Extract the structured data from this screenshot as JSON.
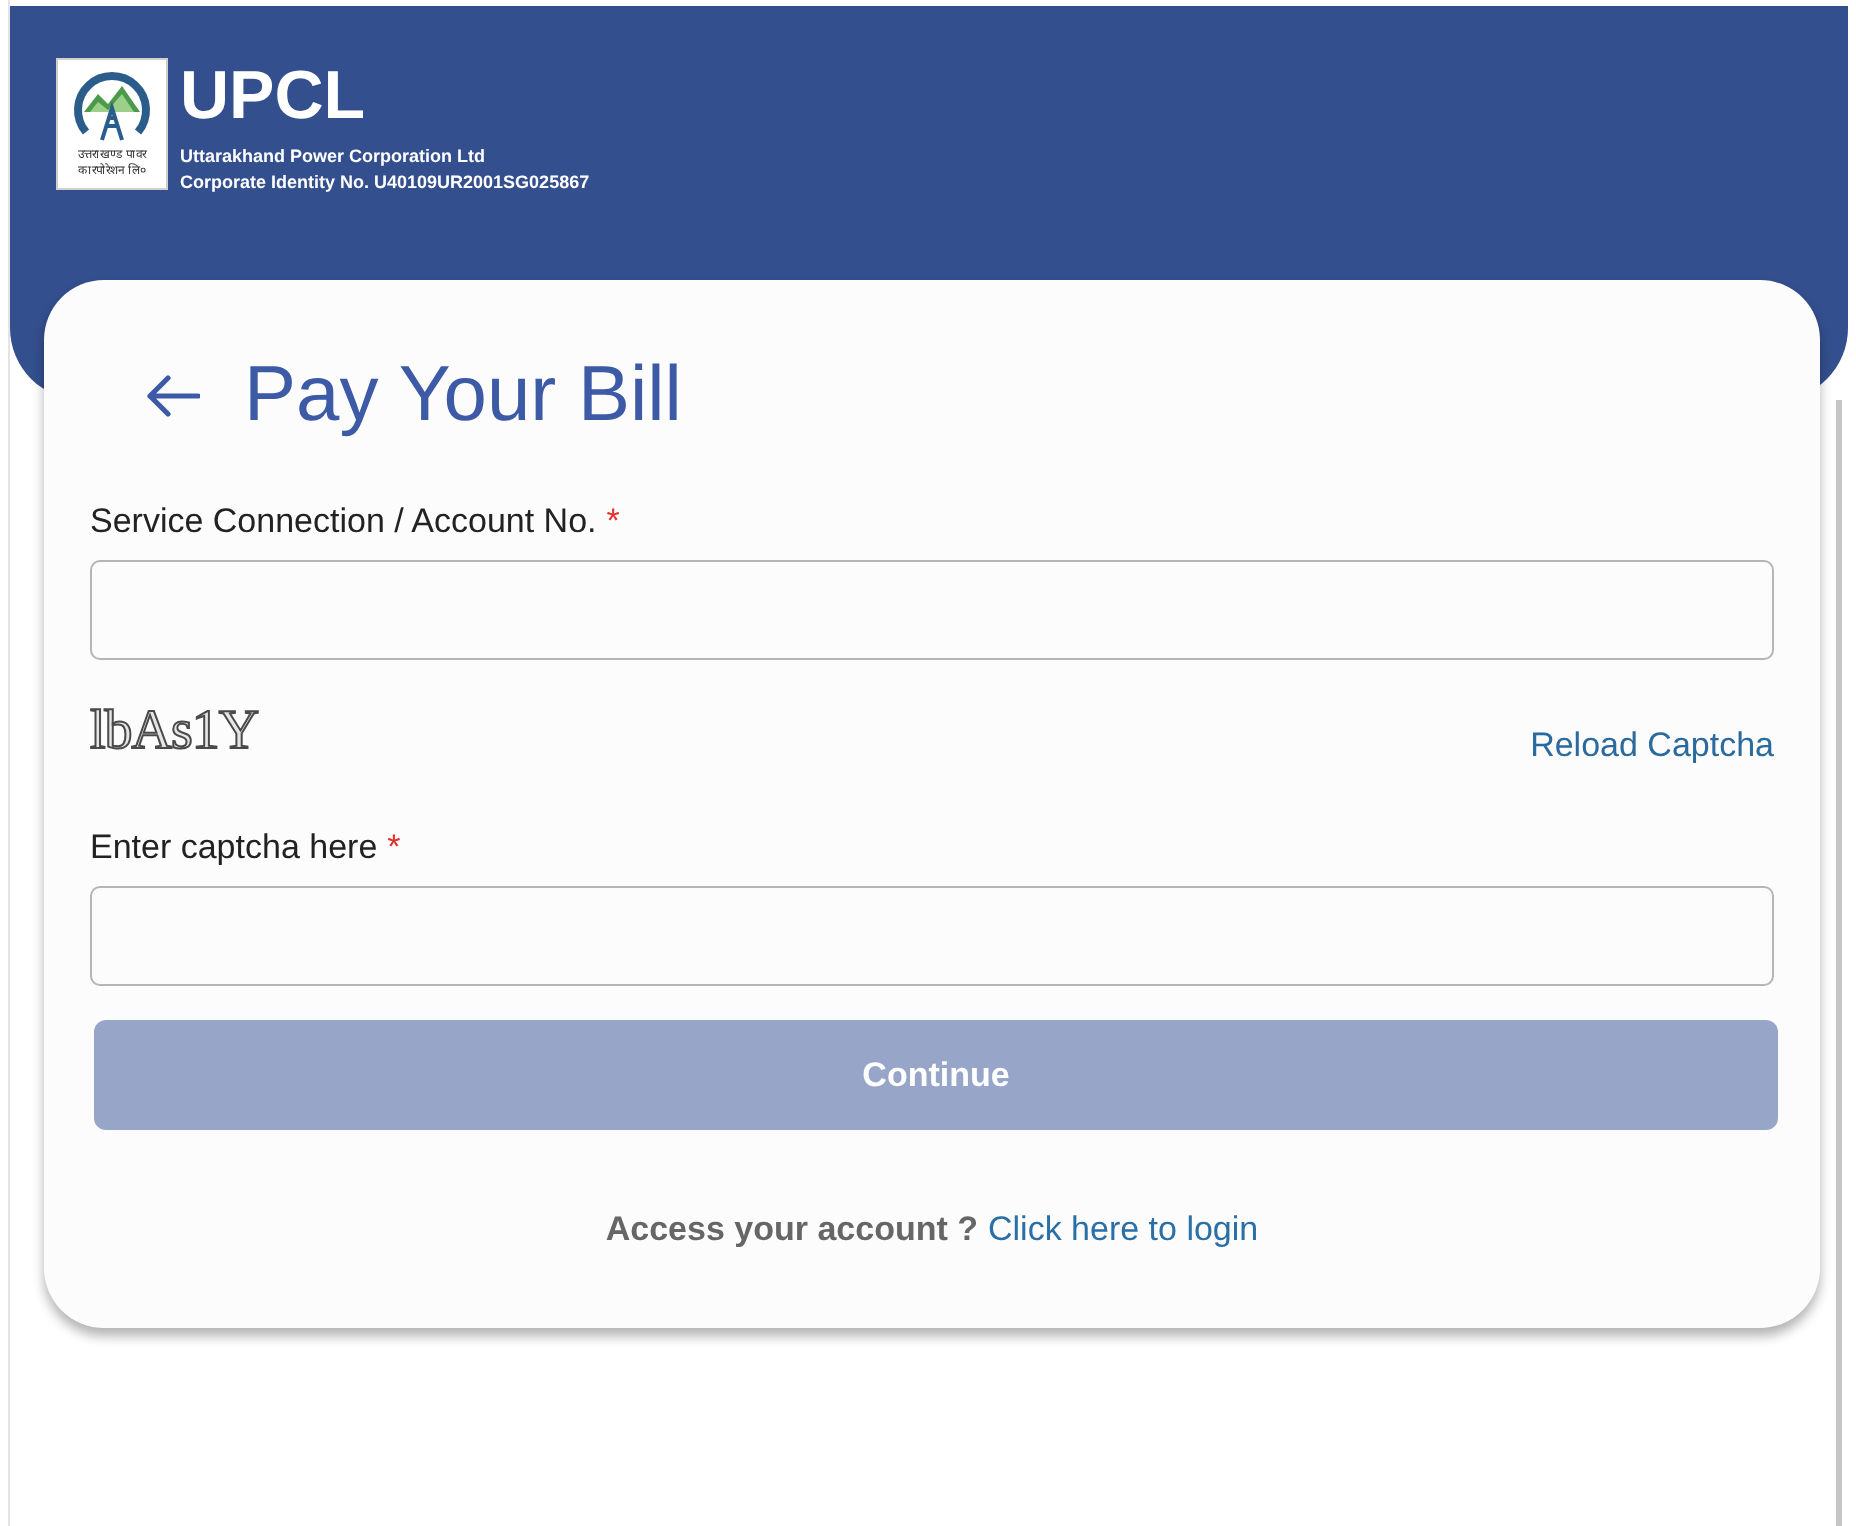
{
  "header": {
    "logo_text": [
      "उत्तराखण्ड पावर",
      "कारपोरेशन लि०"
    ],
    "brand": "UPCL",
    "company": "Uttarakhand Power Corporation Ltd",
    "cin": "Corporate Identity No. U40109UR2001SG025867"
  },
  "form": {
    "title": "Pay Your Bill",
    "fields": [
      {
        "kind": "text",
        "label": "Service Connection / Account No.",
        "required_mark": "*"
      },
      {
        "kind": "captcha",
        "captcha": "lbAs1Y",
        "reload_link": "Reload Captcha"
      },
      {
        "kind": "text",
        "label": "Enter captcha here",
        "required_mark": "*"
      }
    ],
    "continue_button": {
      "label": "Continue",
      "disabled": true
    },
    "footer": {
      "prompt": "Access your account ?",
      "link": "Click here to login"
    }
  }
}
